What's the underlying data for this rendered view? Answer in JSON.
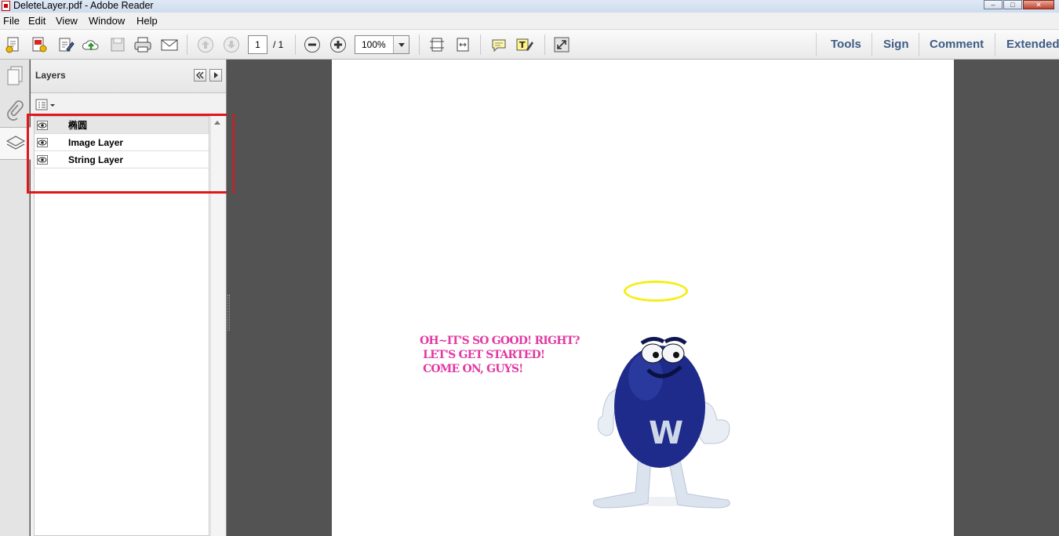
{
  "window": {
    "title": "DeleteLayer.pdf - Adobe Reader",
    "buttons": [
      "–",
      "□",
      "✕"
    ]
  },
  "menu": [
    "File",
    "Edit",
    "View",
    "Window",
    "Help"
  ],
  "toolbar": {
    "page_current": "1",
    "page_total": "/ 1",
    "zoom": "100%",
    "right_links": [
      "Tools",
      "Sign",
      "Comment",
      "Extended"
    ]
  },
  "panel": {
    "title": "Layers",
    "layers": [
      {
        "name": "椭圆",
        "visible": true,
        "selected": true
      },
      {
        "name": "Image Layer",
        "visible": true,
        "selected": false
      },
      {
        "name": "String Layer",
        "visible": true,
        "selected": false
      }
    ]
  },
  "document": {
    "string_layer_text": "OH~IT'S SO GOOD! RIGHT?\n LET'S GET STARTED!\n COME ON, GUYS!",
    "mascot_letter": "W",
    "colors": {
      "halo": "#f5ee17",
      "text": "#e23aa3",
      "mascot_body": "#1e2b8a",
      "highlight_box": "#e0161b"
    }
  }
}
